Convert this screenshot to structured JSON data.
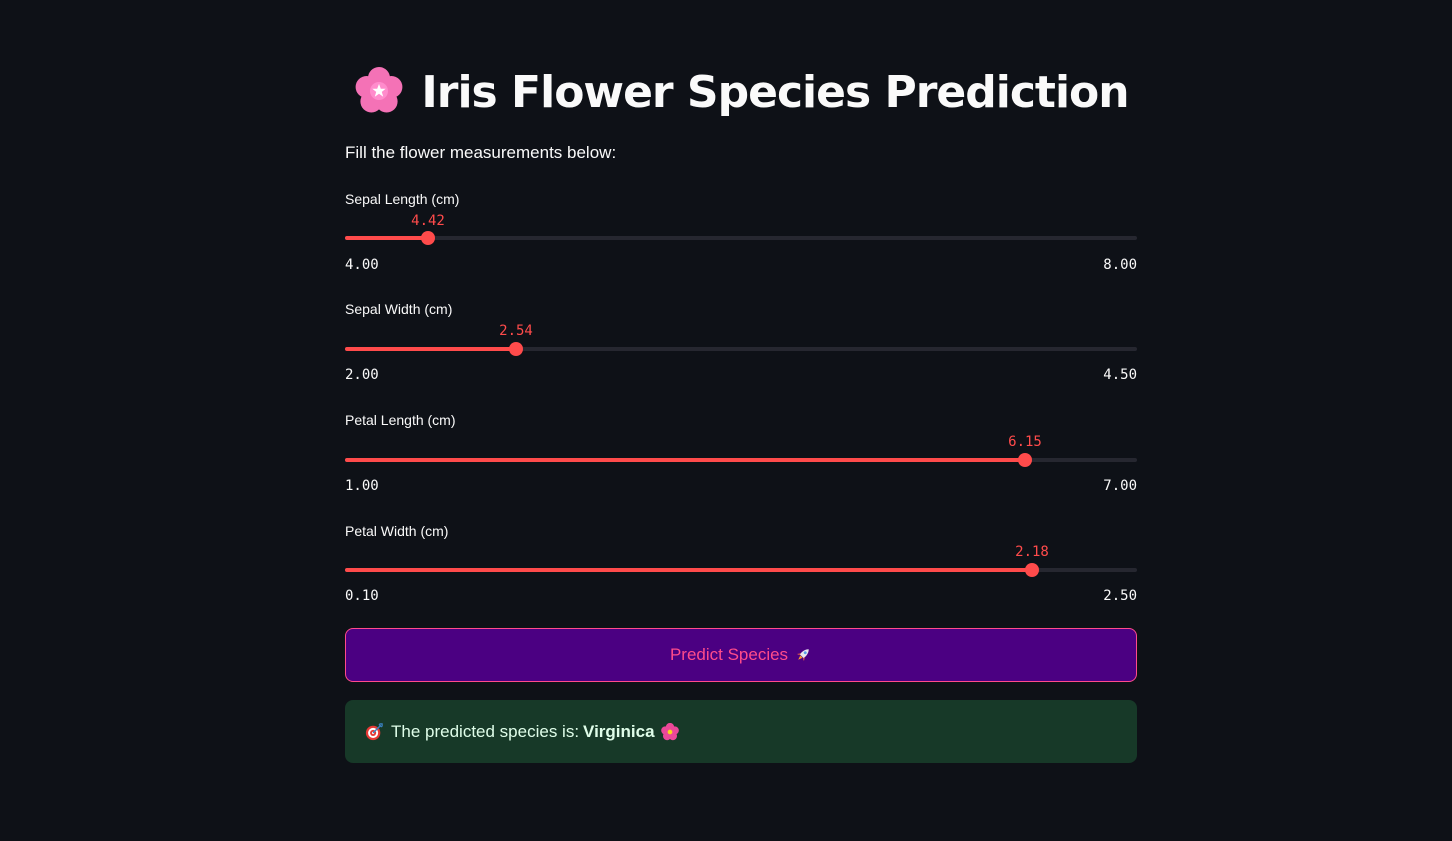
{
  "header": {
    "title": "Iris Flower Species Prediction",
    "title_icon": "cherry-blossom-icon"
  },
  "instructions": "Fill the flower measurements below:",
  "sliders": [
    {
      "label": "Sepal Length (cm)",
      "value": "4.42",
      "min": "4.00",
      "max": "8.00",
      "fraction": 0.105
    },
    {
      "label": "Sepal Width (cm)",
      "value": "2.54",
      "min": "2.00",
      "max": "4.50",
      "fraction": 0.216
    },
    {
      "label": "Petal Length (cm)",
      "value": "6.15",
      "min": "1.00",
      "max": "7.00",
      "fraction": 0.858
    },
    {
      "label": "Petal Width (cm)",
      "value": "2.18",
      "min": "0.10",
      "max": "2.50",
      "fraction": 0.867
    }
  ],
  "predict_button": {
    "label": "Predict Species",
    "icon": "rocket-icon"
  },
  "result": {
    "icon": "direct-hit-icon",
    "prefix": "The predicted species is:",
    "species": "Virginica",
    "suffix_icon": "hibiscus-icon"
  },
  "colors": {
    "background": "#0e1117",
    "accent": "#ff4b4b",
    "button_bg": "#4b0082",
    "button_text": "#ff4b8b",
    "success_bg": "#173928"
  }
}
